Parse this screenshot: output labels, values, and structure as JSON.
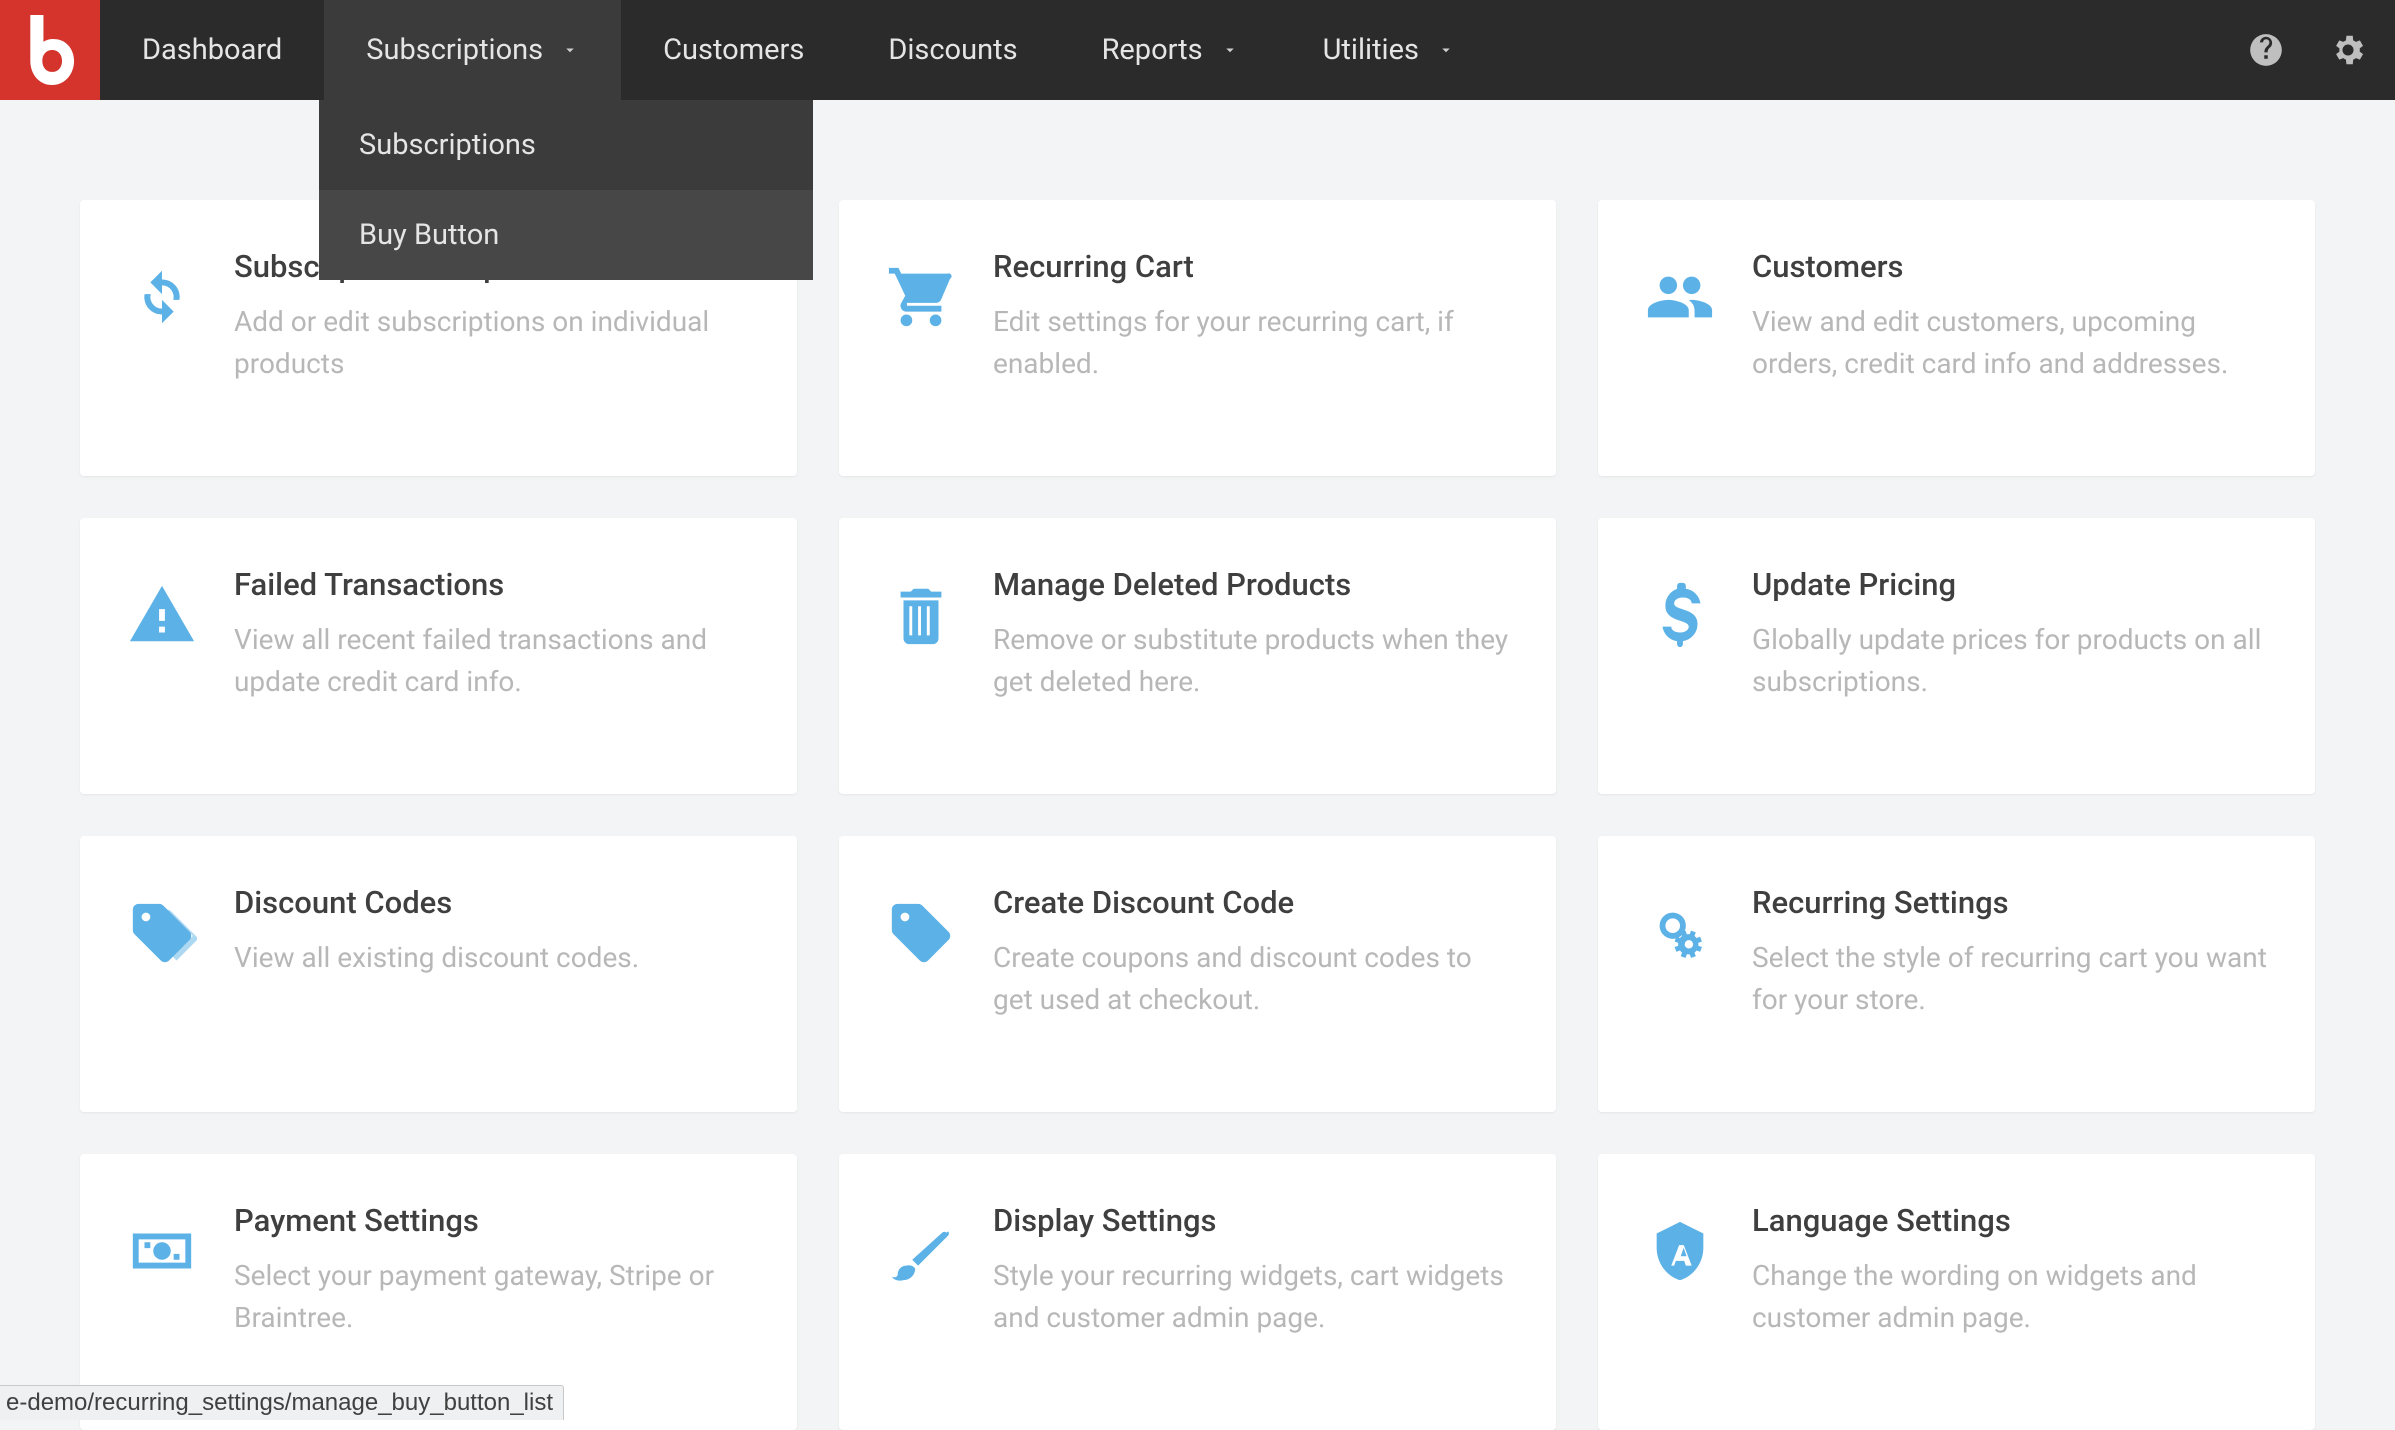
{
  "nav": {
    "dashboard": "Dashboard",
    "subscriptions": "Subscriptions",
    "customers": "Customers",
    "discounts": "Discounts",
    "reports": "Reports",
    "utilities": "Utilities"
  },
  "dropdown": {
    "subscriptions": "Subscriptions",
    "buy_button": "Buy Button"
  },
  "cards": {
    "subscription_groups": {
      "title": "Subscription Groups",
      "desc": "Add or edit subscriptions on individual products"
    },
    "recurring_cart": {
      "title": "Recurring Cart",
      "desc": "Edit settings for your recurring cart, if enabled."
    },
    "customers": {
      "title": "Customers",
      "desc": "View and edit customers, upcoming orders, credit card info and addresses."
    },
    "failed_transactions": {
      "title": "Failed Transactions",
      "desc": "View all recent failed transactions and update credit card info."
    },
    "manage_deleted": {
      "title": "Manage Deleted Products",
      "desc": "Remove or substitute products when they get deleted here."
    },
    "update_pricing": {
      "title": "Update Pricing",
      "desc": "Globally update prices for products on all subscriptions."
    },
    "discount_codes": {
      "title": "Discount Codes",
      "desc": "View all existing discount codes."
    },
    "create_discount": {
      "title": "Create Discount Code",
      "desc": "Create coupons and discount codes to get used at checkout."
    },
    "recurring_settings": {
      "title": "Recurring Settings",
      "desc": "Select the style of recurring cart you want for your store."
    },
    "payment_settings": {
      "title": "Payment Settings",
      "desc": "Select your payment gateway, Stripe or Braintree."
    },
    "display_settings": {
      "title": "Display Settings",
      "desc": "Style your recurring widgets, cart widgets and customer admin page."
    },
    "language_settings": {
      "title": "Language Settings",
      "desc": "Change the wording on widgets and customer admin page."
    }
  },
  "status": "e-demo/recurring_settings/manage_buy_button_list"
}
